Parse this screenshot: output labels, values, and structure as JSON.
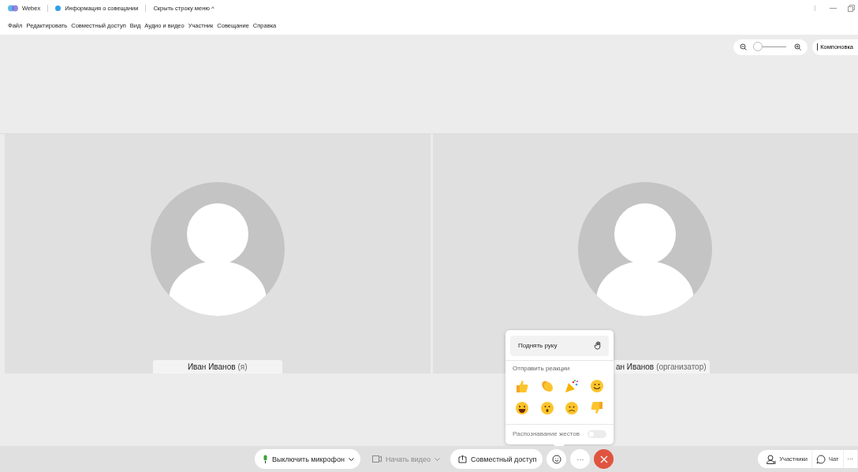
{
  "titlebar": {
    "app": "Webex",
    "info": "Информация о совещании",
    "hide_menu": "Скрыть строку меню",
    "hide_caret": "^"
  },
  "menu": [
    "Файл",
    "Редактировать",
    "Совместный доступ",
    "Вид",
    "Аудио и видео",
    "Участник",
    "Совещание",
    "Справка"
  ],
  "zoom": {
    "level": 0.1
  },
  "layout_button": "Компоновка",
  "tiles": [
    {
      "name": "Иван Иванов",
      "role": "(я)"
    },
    {
      "name": "ан Иванов",
      "role": "(организатор)"
    }
  ],
  "reactions_popup": {
    "raise_hand": "Поднять руку",
    "section": "Отправить реакции",
    "gesture": {
      "label": "Распознавание жестов",
      "on": false
    }
  },
  "toolbar": [
    {
      "label": "Выключить микрофон",
      "kind": "mic",
      "disabled": false
    },
    {
      "label": "Начать видео",
      "kind": "video",
      "disabled": true
    },
    {
      "label": "Совместный доступ",
      "kind": "share",
      "disabled": false
    }
  ],
  "more": "···",
  "right": {
    "participants": "Участники",
    "chat": "Чат",
    "more": "···"
  }
}
